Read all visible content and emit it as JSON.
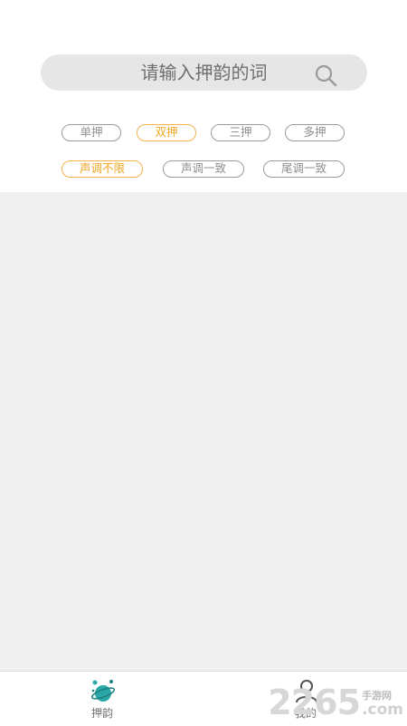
{
  "search": {
    "placeholder": "请输入押韵的词"
  },
  "rhyme_filters": [
    {
      "label": "单押",
      "active": false
    },
    {
      "label": "双押",
      "active": true
    },
    {
      "label": "三押",
      "active": false
    },
    {
      "label": "多押",
      "active": false
    }
  ],
  "tone_filters": [
    {
      "label": "声调不限",
      "active": true
    },
    {
      "label": "声调一致",
      "active": false
    },
    {
      "label": "尾调一致",
      "active": false
    }
  ],
  "colors": {
    "accent": "#f0a524",
    "chip_border": "#9a9a9a",
    "content_bg": "#f0f0f0",
    "icon_teal": "#2aa7a7"
  },
  "tabbar": {
    "tabs": [
      {
        "label": "押韵",
        "icon": "rhyme-planet-icon",
        "active": true
      },
      {
        "label": "我的",
        "icon": "user-icon",
        "active": false
      }
    ]
  },
  "watermark": {
    "number": "2265",
    "sub": "手游网",
    "domain": ".com"
  }
}
